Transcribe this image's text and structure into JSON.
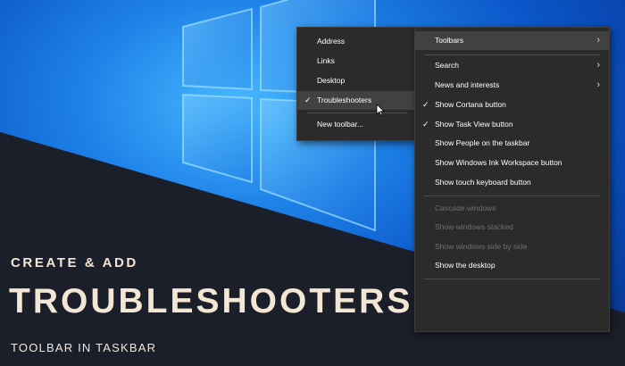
{
  "submenu": {
    "items": [
      {
        "label": "Address",
        "checked": false,
        "highlighted": false
      },
      {
        "label": "Links",
        "checked": false,
        "highlighted": false
      },
      {
        "label": "Desktop",
        "checked": false,
        "highlighted": false
      },
      {
        "label": "Troubleshooters",
        "checked": true,
        "highlighted": true
      },
      {
        "label": "New toolbar...",
        "checked": false,
        "highlighted": false
      }
    ]
  },
  "menu": {
    "items": [
      {
        "label": "Toolbars",
        "submenu": true,
        "highlighted": true
      },
      {
        "label": "Search",
        "submenu": true
      },
      {
        "label": "News and interests",
        "submenu": true
      },
      {
        "label": "Show Cortana button",
        "checked": true
      },
      {
        "label": "Show Task View button",
        "checked": true
      },
      {
        "label": "Show People on the taskbar"
      },
      {
        "label": "Show Windows Ink Workspace button"
      },
      {
        "label": "Show touch keyboard button"
      },
      {
        "label": "Cascade windows",
        "disabled": true
      },
      {
        "label": "Show windows stacked",
        "disabled": true
      },
      {
        "label": "Show windows side by side",
        "disabled": true
      },
      {
        "label": "Show the desktop"
      }
    ]
  },
  "banner": {
    "kicker": "CREATE & ADD",
    "title": "TROUBLESHOOTERS",
    "subtitle": "TOOLBAR IN TASKBAR"
  },
  "icons": {
    "check": "checkmark-icon",
    "arrow": "chevron-right-icon",
    "cursor": "mouse-pointer-icon",
    "logo": "windows-logo"
  },
  "colors": {
    "menu_bg": "#2b2b2b",
    "highlight": "#414141",
    "banner_bg": "#1b1f2a",
    "banner_text": "#f3e6d4",
    "wallpaper": "#1e82e8"
  }
}
